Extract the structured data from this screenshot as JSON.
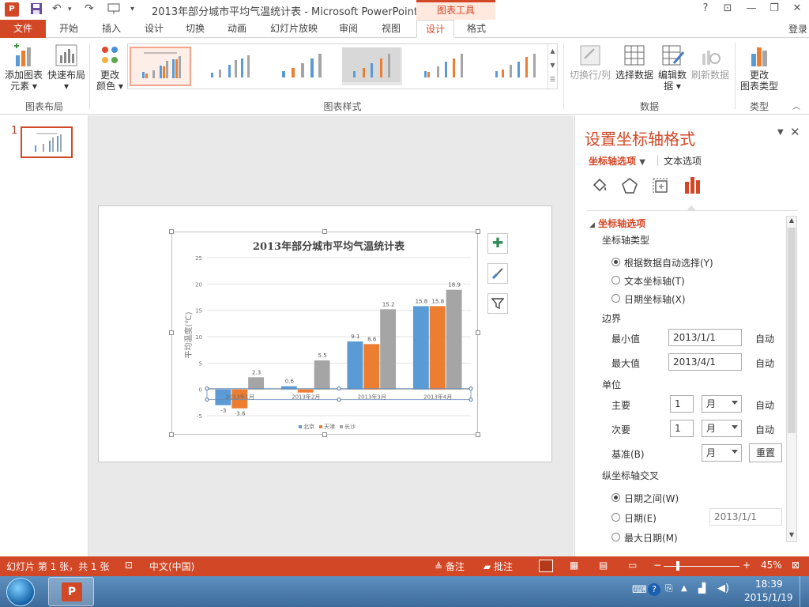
{
  "window": {
    "title": "2013年部分城市平均气温统计表 - Microsoft PowerPoint",
    "context_tab_group": "图表工具",
    "app_logo_text": "P",
    "help": "?",
    "login": "登录"
  },
  "tabs": [
    "文件",
    "开始",
    "插入",
    "设计",
    "切换",
    "动画",
    "幻灯片放映",
    "审阅",
    "视图",
    "设计",
    "格式"
  ],
  "ribbon": {
    "add_element_1": "添加图表",
    "add_element_2": "元素",
    "quick_layout": "快速布局",
    "change_colors_1": "更改",
    "change_colors_2": "颜色",
    "group_layout": "图表布局",
    "group_styles": "图表样式",
    "switch_rowcol": "切换行/列",
    "select_data": "选择数据",
    "edit_data_1": "编辑数",
    "edit_data_2": "据",
    "refresh_data": "刷新数据",
    "group_data": "数据",
    "change_type_1": "更改",
    "change_type_2": "图表类型",
    "group_type": "类型"
  },
  "slide_panel": {
    "slide_number": "1"
  },
  "chart_data": {
    "type": "bar",
    "title": "2013年部分城市平均气温统计表",
    "ylabel": "平均温度(℃)",
    "xlabel": "",
    "categories": [
      "2013年1月",
      "2013年2月",
      "2013年3月",
      "2013年4月"
    ],
    "series": [
      {
        "name": "北京",
        "color": "#5b9bd5",
        "values": [
          -3,
          0.6,
          9.1,
          15.8
        ]
      },
      {
        "name": "天津",
        "color": "#ed7d31",
        "values": [
          -3.6,
          -0.6,
          8.6,
          15.8
        ]
      },
      {
        "name": "长沙",
        "color": "#a5a5a5",
        "values": [
          2.3,
          5.5,
          15.2,
          18.9
        ]
      }
    ],
    "data_labels": [
      [
        "-3",
        "0.6",
        "9.1",
        "15.8"
      ],
      [
        "-3.6",
        "",
        "8.6",
        "15.8"
      ],
      [
        "2.3",
        "5.5",
        "15.2",
        "18.9"
      ]
    ],
    "ylim": [
      -5,
      25
    ],
    "yticks": [
      -5,
      0,
      5,
      10,
      15,
      20,
      25
    ],
    "legend": "bottom",
    "grid": true
  },
  "pane": {
    "title": "设置坐标轴格式",
    "tab_axis_options": "坐标轴选项",
    "tab_text_options": "文本选项",
    "section": "坐标轴选项",
    "axis_type_label": "坐标轴类型",
    "radio_auto": "根据数据自动选择(Y)",
    "radio_text_axis": "文本坐标轴(T)",
    "radio_date_axis": "日期坐标轴(X)",
    "bounds_label": "边界",
    "min_label": "最小值",
    "min_value": "2013/1/1",
    "max_label": "最大值",
    "max_value": "2013/4/1",
    "auto": "自动",
    "units_label": "单位",
    "major_label": "主要",
    "major_value": "1",
    "major_unit": "月",
    "minor_label": "次要",
    "minor_value": "1",
    "minor_unit": "月",
    "base_label": "基准(B)",
    "base_unit": "月",
    "reset_button": "重置",
    "cross_label": "纵坐标轴交叉",
    "radio_between_dates": "日期之间(W)",
    "radio_date": "日期(E)",
    "date_value": "2013/1/1",
    "radio_max_date": "最大日期(M)"
  },
  "status": {
    "slide_info": "幻灯片 第 1 张，共 1 张",
    "language": "中文(中国)",
    "notes": "备注",
    "comments": "批注",
    "zoom": "45%"
  },
  "taskbar": {
    "time": "18:39",
    "date": "2015/1/19"
  }
}
